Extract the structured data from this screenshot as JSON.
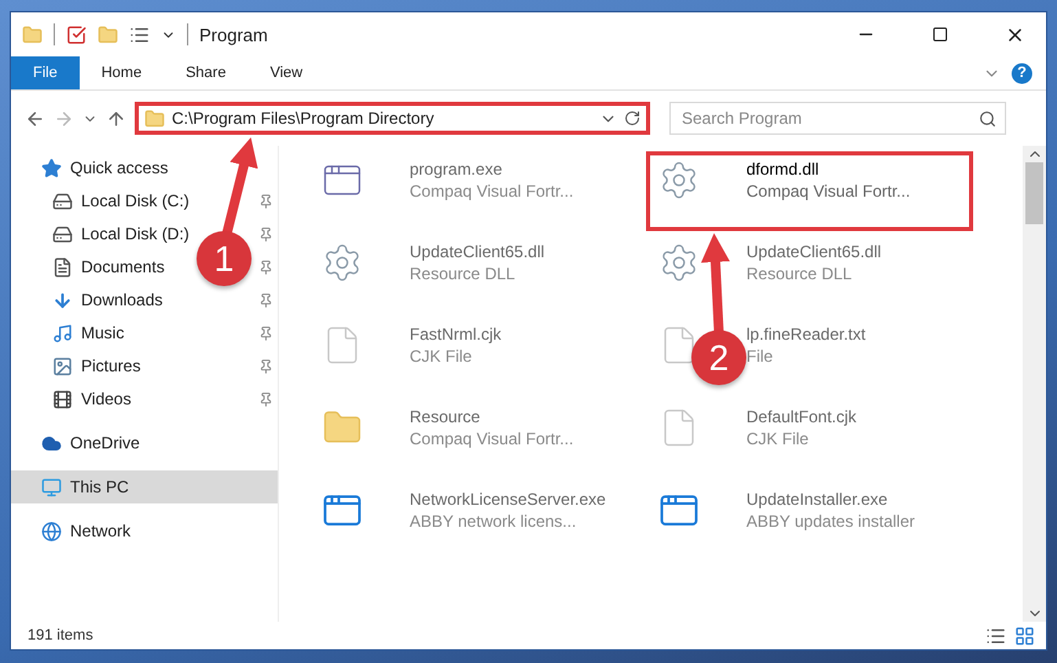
{
  "window": {
    "title": "Program"
  },
  "ribbon": {
    "tabs": [
      {
        "label": "File",
        "selected": true
      },
      {
        "label": "Home",
        "selected": false
      },
      {
        "label": "Share",
        "selected": false
      },
      {
        "label": "View",
        "selected": false
      }
    ],
    "help": "?"
  },
  "address": {
    "path": "C:\\Program Files\\Program Directory",
    "highlighted": true
  },
  "search": {
    "placeholder": "Search Program"
  },
  "sidebar": {
    "items": [
      {
        "label": "Quick access",
        "kind": "quick",
        "selected": false,
        "children": [
          {
            "label": "Local Disk (C:)",
            "kind": "disk-c",
            "pinned": true,
            "selected": false
          },
          {
            "label": "Local Disk (D:)",
            "kind": "disk",
            "pinned": true,
            "selected": false
          },
          {
            "label": "Documents",
            "kind": "documents",
            "pinned": true,
            "selected": false
          },
          {
            "label": "Downloads",
            "kind": "downloads",
            "pinned": true,
            "selected": false
          },
          {
            "label": "Music",
            "kind": "music",
            "pinned": true,
            "selected": false
          },
          {
            "label": "Pictures",
            "kind": "pictures",
            "pinned": true,
            "selected": false
          },
          {
            "label": "Videos",
            "kind": "videos",
            "pinned": true,
            "selected": false
          }
        ]
      },
      {
        "label": "OneDrive",
        "kind": "cloud",
        "selected": false
      },
      {
        "label": "This PC",
        "kind": "pc",
        "selected": true
      },
      {
        "label": "Network",
        "kind": "network",
        "selected": false
      }
    ]
  },
  "files": [
    {
      "name": "program.exe",
      "type": "Compaq Visual Fortr...",
      "kind": "app",
      "blurred": true,
      "highlighted": false
    },
    {
      "name": "dformd.dll",
      "type": "Compaq Visual Fortr...",
      "kind": "dll",
      "blurred": false,
      "highlighted": true
    },
    {
      "name": "UpdateClient65.dll",
      "type": "Resource DLL",
      "kind": "dll",
      "blurred": true,
      "highlighted": false
    },
    {
      "name": "UpdateClient65.dll",
      "type": "Resource DLL",
      "kind": "dll",
      "blurred": true,
      "highlighted": false
    },
    {
      "name": "FastNrml.cjk",
      "type": "CJK File",
      "kind": "file",
      "blurred": true,
      "highlighted": false
    },
    {
      "name": "lp.fineReader.txt",
      "type": "File",
      "kind": "file",
      "blurred": true,
      "highlighted": false
    },
    {
      "name": "Resource",
      "type": "Compaq Visual Fortr...",
      "kind": "folder",
      "blurred": true,
      "highlighted": false
    },
    {
      "name": "DefaultFont.cjk",
      "type": "CJK File",
      "kind": "file",
      "blurred": true,
      "highlighted": false
    },
    {
      "name": "NetworkLicenseServer.exe",
      "type": "ABBY network licens...",
      "kind": "installer",
      "blurred": true,
      "highlighted": false
    },
    {
      "name": "UpdateInstaller.exe",
      "type": "ABBY updates installer",
      "kind": "installer",
      "blurred": true,
      "highlighted": false
    }
  ],
  "status_bar": {
    "count": "191 items"
  },
  "callouts": [
    {
      "label": "1"
    },
    {
      "label": "2"
    }
  ]
}
